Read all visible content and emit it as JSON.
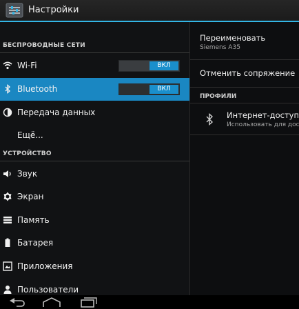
{
  "app": {
    "title": "Настройки",
    "icon": "settings-sliders-icon"
  },
  "colors": {
    "accent": "#33b5e5",
    "selected_row": "#1a87c2",
    "toggle_on": "#1a8fcc"
  },
  "sections": {
    "wireless": "БЕСПРОВОДНЫЕ СЕТИ",
    "device": "УСТРОЙСТВО"
  },
  "wireless_items": [
    {
      "label": "Wi-Fi",
      "icon": "wifi-icon",
      "toggle": "ВКЛ"
    },
    {
      "label": "Bluetooth",
      "icon": "bluetooth-icon",
      "toggle": "ВКЛ",
      "selected": true
    },
    {
      "label": "Передача данных",
      "icon": "data-usage-icon"
    },
    {
      "label": "Ещё..."
    }
  ],
  "device_items": [
    {
      "label": "Звук",
      "icon": "speaker-icon"
    },
    {
      "label": "Экран",
      "icon": "brightness-icon"
    },
    {
      "label": "Память",
      "icon": "storage-icon"
    },
    {
      "label": "Батарея",
      "icon": "battery-icon"
    },
    {
      "label": "Приложения",
      "icon": "apps-icon"
    },
    {
      "label": "Пользователи",
      "icon": "user-icon"
    }
  ],
  "detail": {
    "rename": {
      "title": "Переименовать",
      "subtitle": "Siemens A35"
    },
    "unpair": "Отменить сопряжение",
    "profiles_header": "ПРОФИЛИ",
    "profile": {
      "title": "Интернет-доступ",
      "subtitle": "Использовать для дос",
      "icon": "bluetooth-icon"
    }
  },
  "nav": [
    "back-icon",
    "home-icon",
    "recent-apps-icon"
  ]
}
